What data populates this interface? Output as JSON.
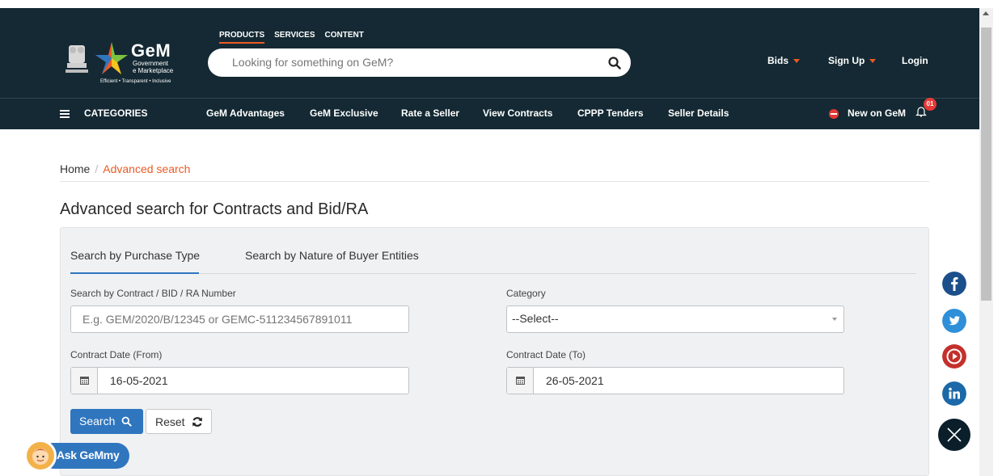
{
  "header": {
    "logo": {
      "title": "GeM",
      "sub1": "Government",
      "sub2": "e Marketplace",
      "tagline": "Efficient • Transparent • Inclusive"
    },
    "product_tabs": [
      "PRODUCTS",
      "SERVICES",
      "CONTENT"
    ],
    "search": {
      "placeholder": "Looking for something on GeM?"
    },
    "right_links": {
      "bids": "Bids",
      "signup": "Sign Up",
      "login": "Login"
    }
  },
  "nav": {
    "categories": "CATEGORIES",
    "items": [
      "GeM Advantages",
      "GeM Exclusive",
      "Rate a Seller",
      "View Contracts",
      "CPPP Tenders",
      "Seller Details"
    ],
    "new_on_gem": "New on GeM",
    "notification_count": "01"
  },
  "breadcrumb": {
    "home": "Home",
    "separator": "/",
    "current": "Advanced search"
  },
  "page_title": "Advanced search for Contracts and Bid/RA",
  "form": {
    "tabs": [
      "Search by Purchase Type",
      "Search by Nature of Buyer Entities"
    ],
    "contract_number": {
      "label": "Search by Contract / BID / RA Number",
      "placeholder": "E.g. GEM/2020/B/12345 or GEMC-511234567891011"
    },
    "category": {
      "label": "Category",
      "value": "--Select--"
    },
    "date_from": {
      "label": "Contract Date (From)",
      "value": "16-05-2021"
    },
    "date_to": {
      "label": "Contract Date (To)",
      "value": "26-05-2021"
    },
    "search_button": "Search",
    "reset_button": "Reset"
  },
  "social": [
    "facebook-icon",
    "twitter-icon",
    "youtube-icon",
    "linkedin-icon",
    "close-icon"
  ],
  "colors": {
    "header_bg": "#142933",
    "accent": "#ec5a25",
    "primary": "#2f76bf"
  },
  "chat": {
    "label": "Ask GeMmy"
  }
}
